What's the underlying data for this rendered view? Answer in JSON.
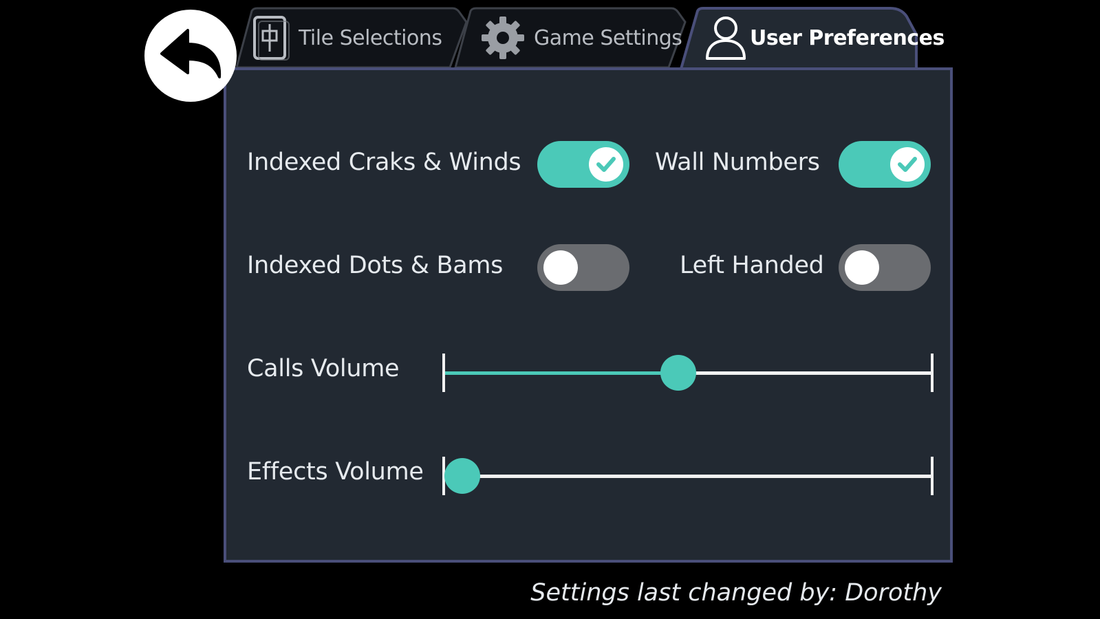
{
  "tabs": [
    {
      "label": "Tile Selections",
      "icon": "mahjong-tile-icon",
      "active": false
    },
    {
      "label": "Game Settings",
      "icon": "gear-icon",
      "active": false
    },
    {
      "label": "User Preferences",
      "icon": "user-icon",
      "active": true
    }
  ],
  "toggles": {
    "indexed_craks_winds": {
      "label": "Indexed Craks & Winds",
      "on": true
    },
    "wall_numbers": {
      "label": "Wall Numbers",
      "on": true
    },
    "indexed_dots_bams": {
      "label": "Indexed Dots & Bams",
      "on": false
    },
    "left_handed": {
      "label": "Left Handed",
      "on": false
    }
  },
  "sliders": {
    "calls_volume": {
      "label": "Calls Volume",
      "value": 0.48
    },
    "effects_volume": {
      "label": "Effects Volume",
      "value": 0.04
    }
  },
  "footer": {
    "note": "Settings last changed by: Dorothy"
  },
  "colors": {
    "accent": "#4bc9b8",
    "panel_bg": "#222932",
    "panel_border": "#4a4f7a",
    "toggle_off": "#6a6c70"
  }
}
